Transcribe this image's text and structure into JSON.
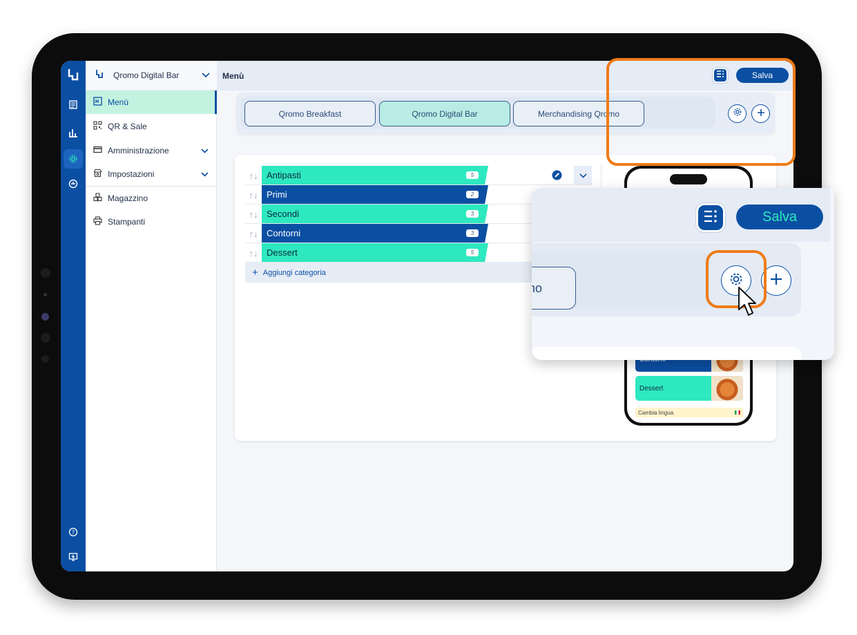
{
  "header": {
    "title": "Menù",
    "save_label": "Salva"
  },
  "venue_switcher": {
    "name": "Qromo Digital Bar"
  },
  "nav": {
    "items": [
      {
        "label": "Menù",
        "icon": "menu-book-icon",
        "active": true
      },
      {
        "label": "QR & Sale",
        "icon": "qr-code-icon"
      },
      {
        "label": "Amministrazione",
        "icon": "card-icon",
        "has_submenu": true
      },
      {
        "label": "Impostazioni",
        "icon": "store-settings-icon",
        "has_submenu": true
      },
      {
        "label": "Magazzino",
        "icon": "boxes-icon"
      },
      {
        "label": "Stampanti",
        "icon": "printer-icon"
      }
    ]
  },
  "rail": {
    "icons": [
      "logo-icon",
      "menu-icon",
      "stats-icon",
      "settings-icon",
      "account-icon",
      "help-icon",
      "monitor-icon"
    ]
  },
  "venue_tabs": [
    {
      "label": "Qromo Breakfast",
      "active": false
    },
    {
      "label": "Qromo Digital Bar",
      "active": true
    },
    {
      "label": "Merchandising Qromo",
      "active": false
    }
  ],
  "categories": [
    {
      "name": "Antipasti",
      "count": "5",
      "color": "green"
    },
    {
      "name": "Primi",
      "count": "2",
      "color": "blue"
    },
    {
      "name": "Secondi",
      "count": "3",
      "color": "green"
    },
    {
      "name": "Contorni",
      "count": "3",
      "color": "blue"
    },
    {
      "name": "Dessert",
      "count": "5",
      "color": "green"
    }
  ],
  "add_category_label": "Aggiungi categoria",
  "phone_preview": {
    "cards": [
      {
        "label": "Contorni"
      },
      {
        "label": "Dessert"
      }
    ],
    "language_label": "Cambia lingua"
  },
  "zoom": {
    "save_label": "Salva",
    "tab_fragment": "no"
  },
  "colors": {
    "primary": "#0b4fa3",
    "accent": "#2ee8bf",
    "highlight": "#f07b18",
    "active_nav": "#c3f2e0"
  }
}
